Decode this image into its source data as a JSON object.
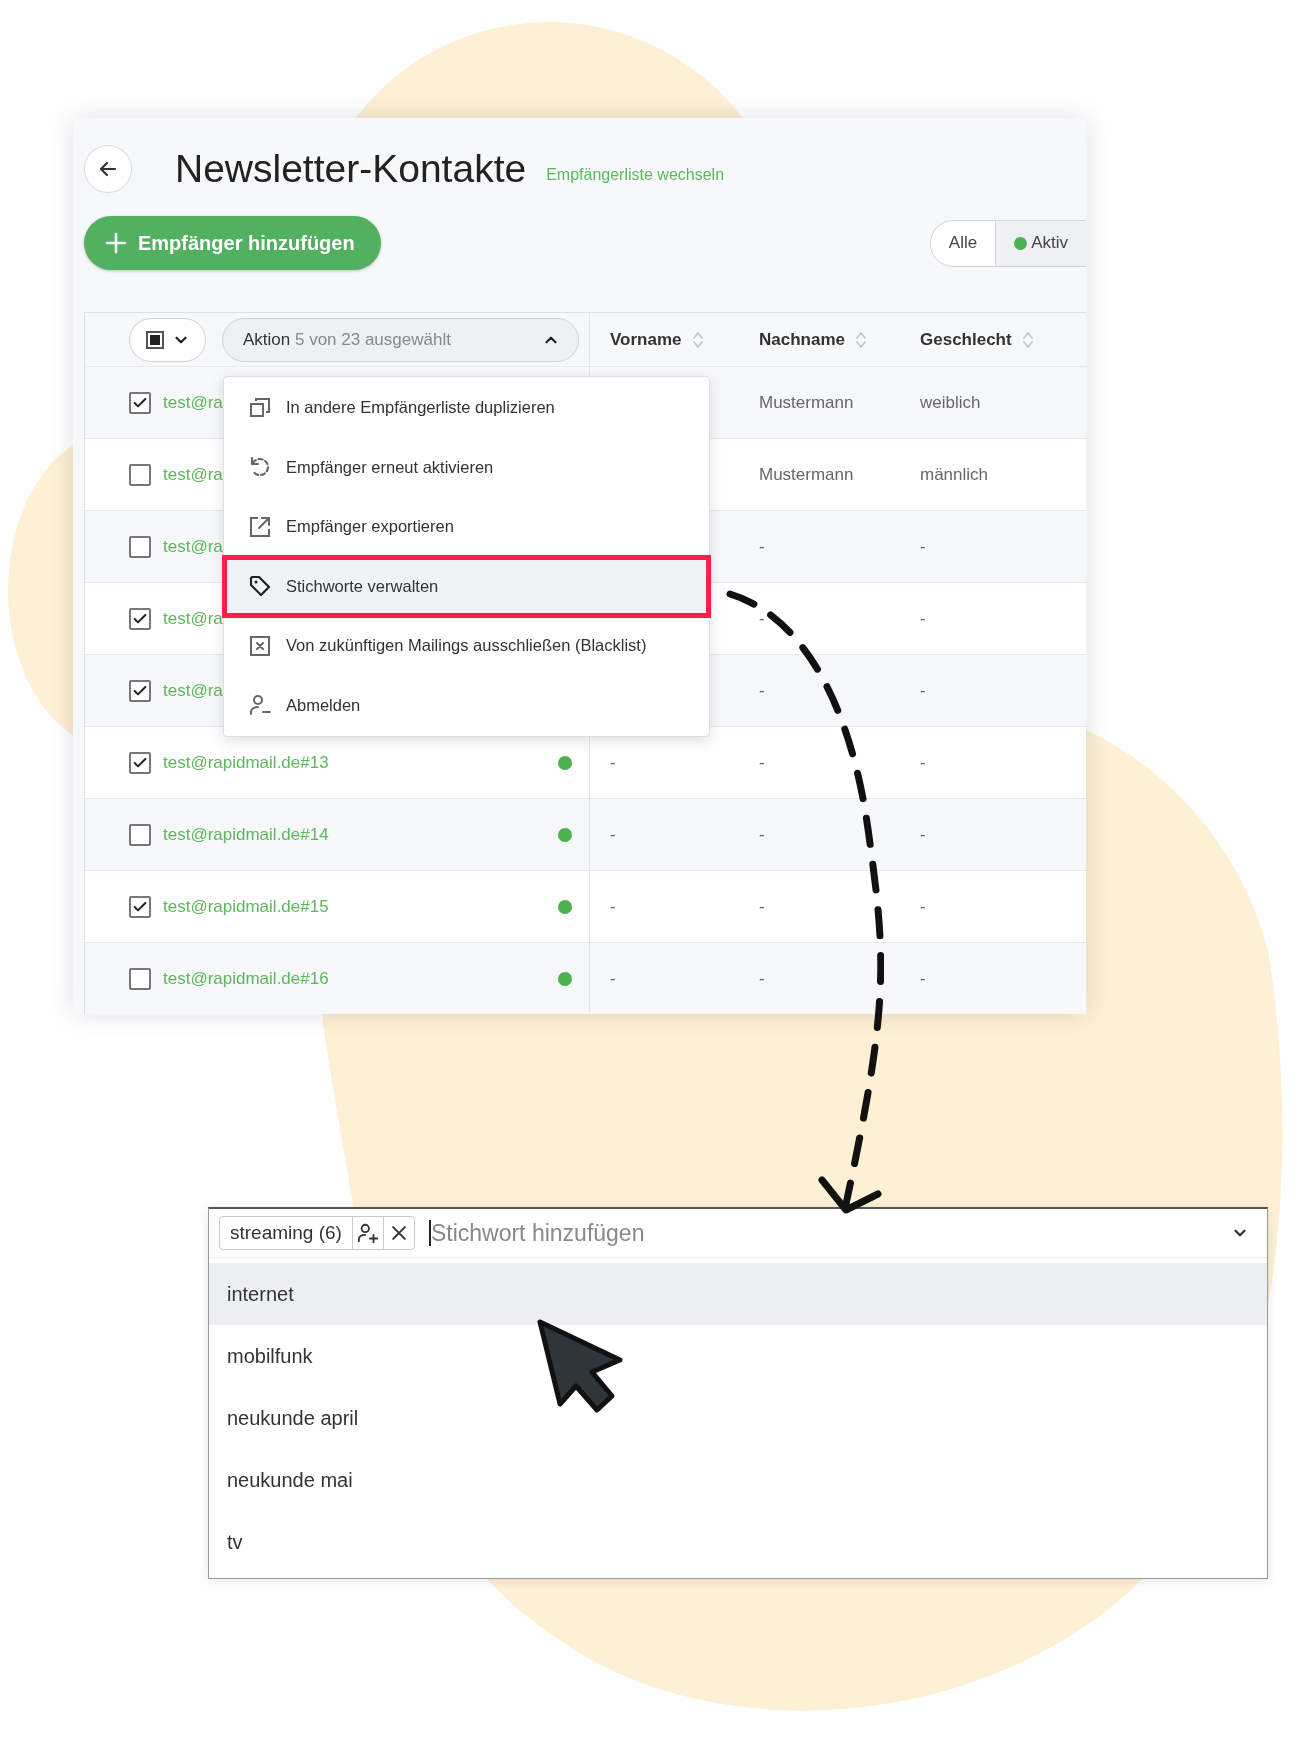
{
  "page": {
    "title": "Newsletter-Kontakte",
    "switch_link": "Empfängerliste wechseln",
    "add_button": "Empfänger hinzufügen",
    "filter": [
      {
        "label": "Alle",
        "selected": false,
        "dot": false
      },
      {
        "label": "Aktiv",
        "selected": true,
        "dot": true
      }
    ]
  },
  "table": {
    "select_all": {
      "indeterminate": true
    },
    "action": {
      "label": "Aktion",
      "selection": "5 von 23 ausgewählt",
      "expanded": true
    },
    "columns": [
      "Vorname",
      "Nachname",
      "Geschlecht"
    ],
    "rows": [
      {
        "checked": true,
        "email": "test@ra",
        "nachname": "Mustermann",
        "geschlecht": "weiblich"
      },
      {
        "checked": false,
        "email": "test@ra",
        "nachname": "Mustermann",
        "geschlecht": "männlich"
      },
      {
        "checked": false,
        "email": "test@ra",
        "nachname": "-",
        "geschlecht": "-"
      },
      {
        "checked": true,
        "email": "test@ra",
        "nachname": "-",
        "geschlecht": "-"
      },
      {
        "checked": true,
        "email": "test@ra",
        "nachname": "-",
        "geschlecht": "-"
      },
      {
        "checked": true,
        "email": "test@rapidmail.de#13",
        "active": true,
        "vorname": "-",
        "nachname": "-",
        "geschlecht": "-"
      },
      {
        "checked": false,
        "email": "test@rapidmail.de#14",
        "active": true,
        "vorname": "-",
        "nachname": "-",
        "geschlecht": "-"
      },
      {
        "checked": true,
        "email": "test@rapidmail.de#15",
        "active": true,
        "vorname": "-",
        "nachname": "-",
        "geschlecht": "-"
      },
      {
        "checked": false,
        "email": "test@rapidmail.de#16",
        "active": true,
        "vorname": "-",
        "nachname": "-",
        "geschlecht": "-"
      }
    ]
  },
  "action_menu": {
    "items": [
      {
        "label": "In andere Empfängerliste duplizieren",
        "selected": false
      },
      {
        "label": "Empfänger erneut aktivieren",
        "selected": false
      },
      {
        "label": "Empfänger exportieren",
        "selected": false
      },
      {
        "label": "Stichworte verwalten",
        "selected": true
      },
      {
        "label": "Von zukünftigen Mailings ausschließen (Blacklist)",
        "selected": false
      },
      {
        "label": "Abmelden",
        "selected": false
      }
    ]
  },
  "tag_picker": {
    "tags": [
      {
        "label": "streaming (6)"
      }
    ],
    "placeholder": "Stichwort hinzufügen",
    "options": [
      {
        "label": "internet",
        "hovered": true
      },
      {
        "label": "mobilfunk",
        "hovered": false
      },
      {
        "label": "neukunde april",
        "hovered": false
      },
      {
        "label": "neukunde mai",
        "hovered": false
      },
      {
        "label": "tv",
        "hovered": false
      }
    ]
  }
}
